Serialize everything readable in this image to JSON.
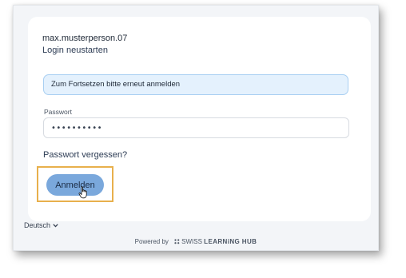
{
  "login": {
    "username": "max.musterperson.07",
    "restart_link": "Login neustarten",
    "info_message": "Zum Fortsetzen bitte erneut anmelden",
    "password_label": "Passwort",
    "password_value": "••••••••••",
    "forgot_link": "Passwort vergessen?",
    "submit_label": "Anmelden"
  },
  "footer": {
    "language": "Deutsch",
    "powered_by": "Powered by",
    "brand_prefix": "SWISS ",
    "brand_bold": "LEARNiNG HUB"
  },
  "colors": {
    "button": "#7aa8dc",
    "banner_bg": "#e4f1fd",
    "banner_border": "#a8cff2",
    "highlight": "#e8b04c",
    "page_bg": "#f3f5f8"
  },
  "icons": [
    "chevron-down-icon",
    "hand-cursor-icon",
    "hub-logo-icon"
  ]
}
